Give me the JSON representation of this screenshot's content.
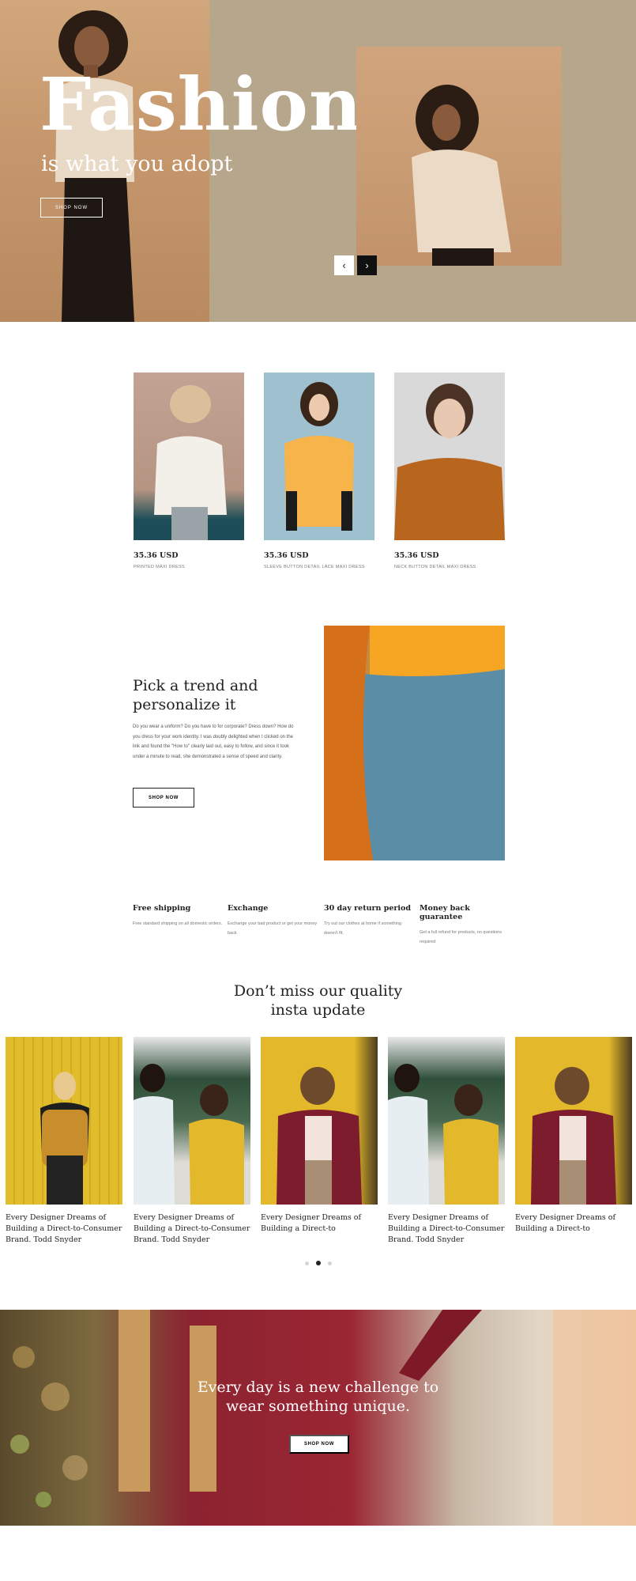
{
  "hero": {
    "title": "Fashion",
    "subtitle": "is what you adopt",
    "cta": "SHOP NOW",
    "prev_icon": "chevron-left-icon",
    "next_icon": "chevron-right-icon",
    "prev_glyph": "‹",
    "next_glyph": "›"
  },
  "products": [
    {
      "price": "35.36 USD",
      "name": "PRINTED MAXI DRESS"
    },
    {
      "price": "35.36 USD",
      "name": "SLEEVE BUTTON DETAIL LACE MAXI DRESS"
    },
    {
      "price": "35.36 USD",
      "name": "NECK BUTTON DETAIL MAXI DRESS"
    }
  ],
  "trend": {
    "title_line1": "Pick a trend and",
    "title_line2": "personalize it",
    "text": "Do you wear a uniform? Do you have to for corporate? Dress down? How do you dress for your work identity. I was doubly delighted when I clicked on the link and found the \"How to\" clearly laid out, easy to follow, and since it took under a minute to read, she demonstrated a sense of speed and clarity.",
    "cta": "SHOP NOW"
  },
  "features": [
    {
      "title": "Free shipping",
      "desc": "Free standard shipping on all domestic orders."
    },
    {
      "title": "Exchange",
      "desc": "Exchange your bad product or get your money back"
    },
    {
      "title": "30 day return period",
      "desc": "Try out our clothes at home if something doesn't fit."
    },
    {
      "title": "Money back guarantee",
      "desc": "Get a full refund for products, no questions required"
    }
  ],
  "insta": {
    "title_line1": "Don’t miss our quality",
    "title_line2": "insta update",
    "cards": [
      {
        "caption": "Every Designer Dreams of Building a Direct-to-Consumer Brand. Todd Snyder"
      },
      {
        "caption": "Every Designer Dreams of Building a Direct-to-Consumer Brand. Todd Snyder"
      },
      {
        "caption": "Every Designer Dreams of Building a Direct-to"
      },
      {
        "caption": "Every Designer Dreams of Building a Direct-to-Consumer Brand. Todd Snyder"
      },
      {
        "caption": "Every Designer Dreams of Building a Direct-to"
      }
    ],
    "active_dot": 2
  },
  "banner": {
    "line1": "Every day is a new challenge to",
    "line2": "wear something unique.",
    "cta": "SHOP NOW"
  },
  "colors": {
    "hero_bg": "#b6a68b",
    "hero_left": "#c6976c",
    "banner_red": "#9a2633",
    "yellow": "#e0b92a"
  }
}
